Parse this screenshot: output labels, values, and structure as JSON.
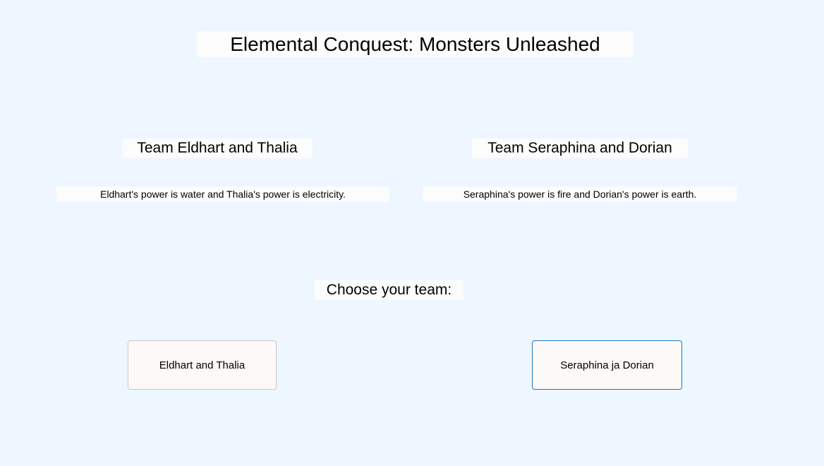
{
  "window": {
    "title": "Elemental Conquest: Monsters Unleashed"
  },
  "teams": [
    {
      "heading": "Team Eldhart and Thalia",
      "description": "Eldhart's power is water and Thalia's power is electricity."
    },
    {
      "heading": "Team Seraphina and Dorian",
      "description": "Seraphina's power is fire and Dorian's power is earth."
    }
  ],
  "prompt": "Choose your team:",
  "buttons": [
    {
      "label": "Eldhart and Thalia",
      "focused": false
    },
    {
      "label": "Seraphina ja Dorian",
      "focused": true
    }
  ],
  "colors": {
    "background": "#EEF6FF",
    "label_background": "#FCFCFD",
    "button_background": "#FDF9F8",
    "button_border": "#C9C9C9",
    "focus_border": "#1F74C8"
  }
}
